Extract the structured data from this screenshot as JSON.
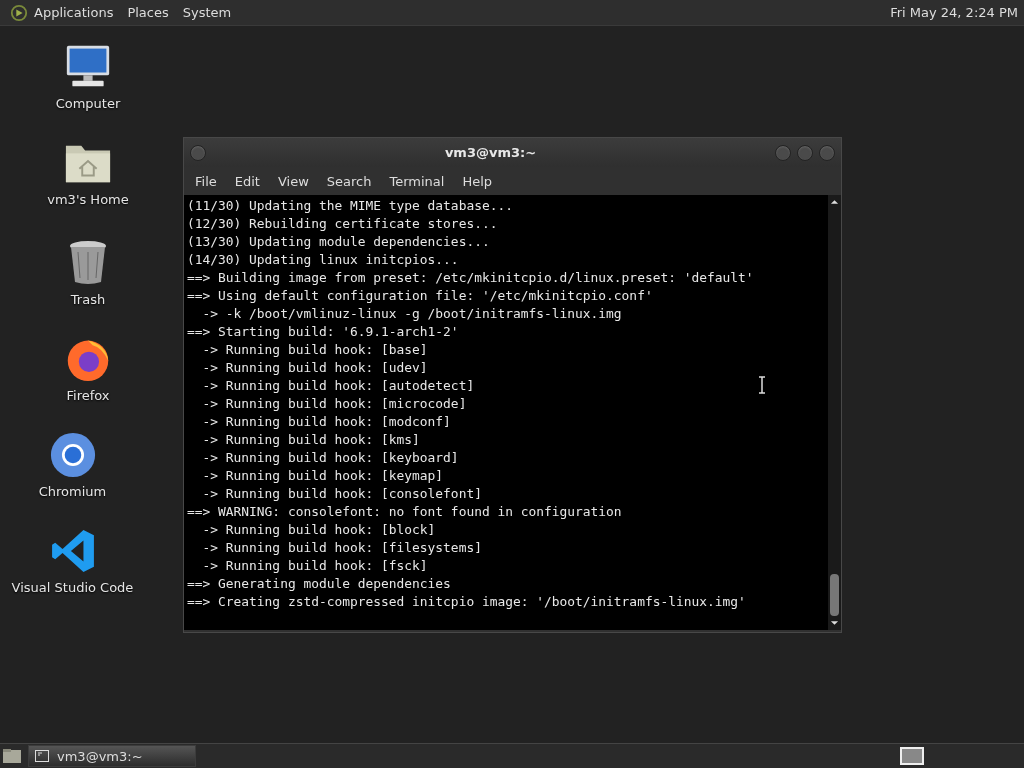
{
  "top_panel": {
    "menus": [
      "Applications",
      "Places",
      "System"
    ],
    "clock": "Fri May 24,  2:24 PM"
  },
  "desktop_icons": [
    {
      "kind": "computer",
      "label": "Computer"
    },
    {
      "kind": "home",
      "label": "vm3's Home"
    },
    {
      "kind": "trash",
      "label": "Trash"
    },
    {
      "kind": "firefox",
      "label": "Firefox"
    },
    {
      "kind": "chromium",
      "label": "Chromium"
    },
    {
      "kind": "vscode",
      "label": "Visual Studio Code"
    }
  ],
  "window": {
    "title": "vm3@vm3:~",
    "menu": [
      "File",
      "Edit",
      "View",
      "Search",
      "Terminal",
      "Help"
    ],
    "lines": [
      "(11/30) Updating the MIME type database...",
      "(12/30) Rebuilding certificate stores...",
      "(13/30) Updating module dependencies...",
      "(14/30) Updating linux initcpios...",
      "==> Building image from preset: /etc/mkinitcpio.d/linux.preset: 'default'",
      "==> Using default configuration file: '/etc/mkinitcpio.conf'",
      "  -> -k /boot/vmlinuz-linux -g /boot/initramfs-linux.img",
      "==> Starting build: '6.9.1-arch1-2'",
      "  -> Running build hook: [base]",
      "  -> Running build hook: [udev]",
      "  -> Running build hook: [autodetect]",
      "  -> Running build hook: [microcode]",
      "  -> Running build hook: [modconf]",
      "  -> Running build hook: [kms]",
      "  -> Running build hook: [keyboard]",
      "  -> Running build hook: [keymap]",
      "  -> Running build hook: [consolefont]",
      "==> WARNING: consolefont: no font found in configuration",
      "  -> Running build hook: [block]",
      "  -> Running build hook: [filesystems]",
      "  -> Running build hook: [fsck]",
      "==> Generating module dependencies",
      "==> Creating zstd-compressed initcpio image: '/boot/initramfs-linux.img'"
    ]
  },
  "taskbar": {
    "tasks": [
      {
        "label": "vm3@vm3:~",
        "selected": true
      }
    ]
  }
}
